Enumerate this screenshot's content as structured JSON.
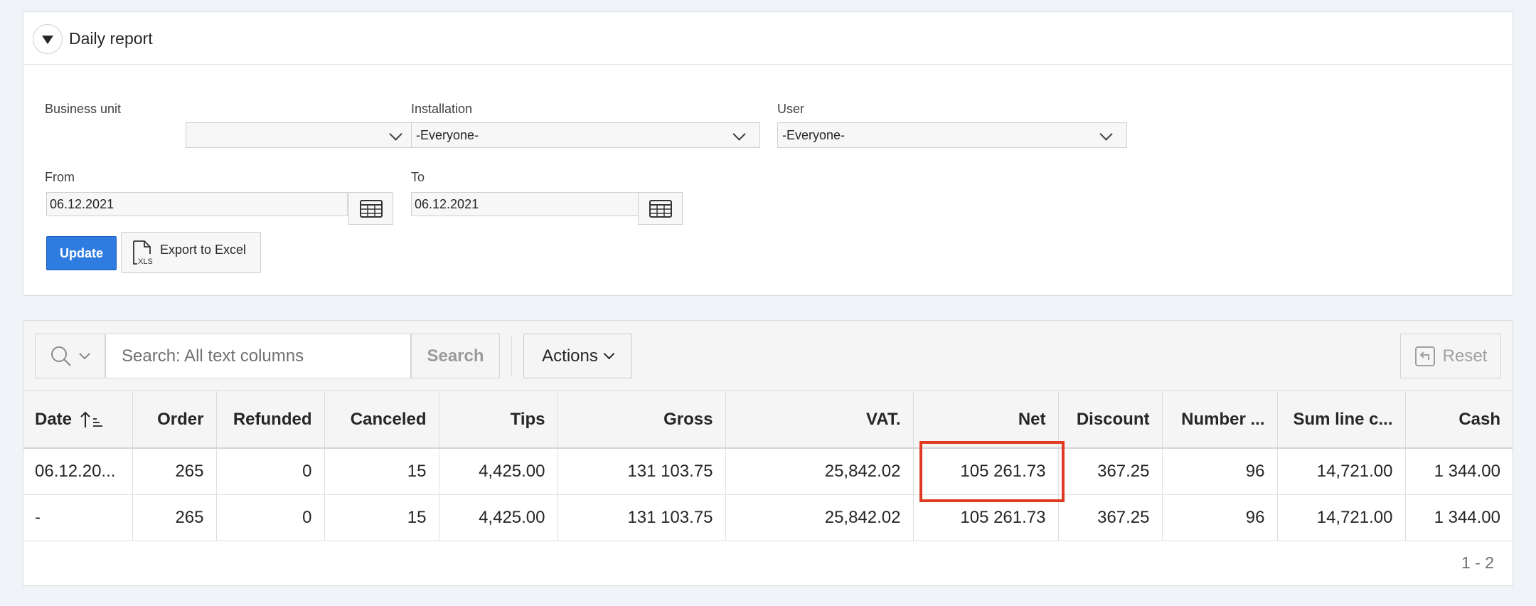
{
  "region": {
    "title": "Daily report"
  },
  "form": {
    "business_unit": {
      "label": "Business unit",
      "value": ""
    },
    "installation": {
      "label": "Installation",
      "value": "-Everyone-"
    },
    "user": {
      "label": "User",
      "value": "-Everyone-"
    },
    "from": {
      "label": "From",
      "value": "06.12.2021"
    },
    "to": {
      "label": "To",
      "value": "06.12.2021"
    },
    "update_label": "Update",
    "export_label": "Export to Excel"
  },
  "toolbar": {
    "search_placeholder": "Search: All text columns",
    "search_label": "Search",
    "actions_label": "Actions",
    "reset_label": "Reset"
  },
  "table": {
    "columns": [
      "Date",
      "Order",
      "Refunded",
      "Canceled",
      "Tips",
      "Gross",
      "VAT.",
      "Net",
      "Discount",
      "Number ...",
      "Sum line c...",
      "Cash"
    ],
    "rows": [
      [
        "06.12.20...",
        "265",
        "0",
        "15",
        "4,425.00",
        "131 103.75",
        "25,842.02",
        "105 261.73",
        "367.25",
        "96",
        "14,721.00",
        "1 344.00"
      ],
      [
        "-",
        "265",
        "0",
        "15",
        "4,425.00",
        "131 103.75",
        "25,842.02",
        "105 261.73",
        "367.25",
        "96",
        "14,721.00",
        "1 344.00"
      ]
    ],
    "pagination": "1 - 2"
  },
  "colors": {
    "primary": "#2f7ce0",
    "highlight": "#e03b22"
  }
}
